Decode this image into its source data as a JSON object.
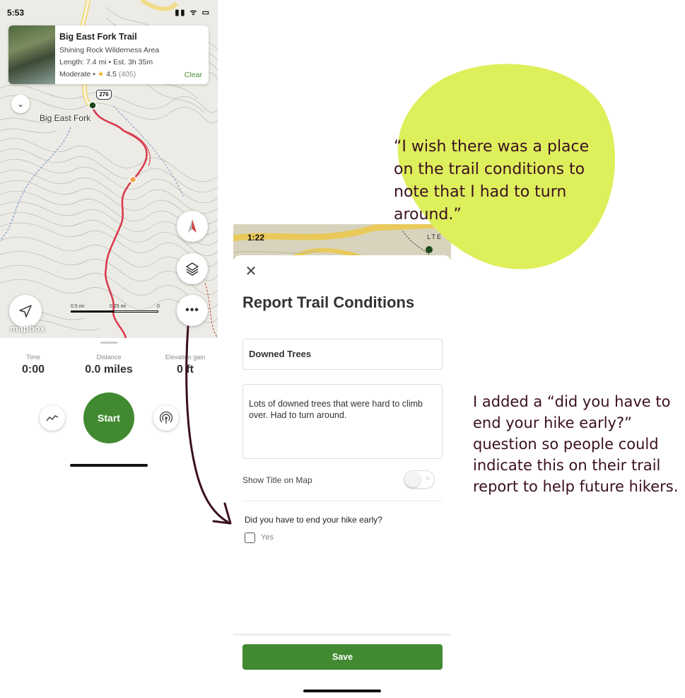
{
  "left_phone": {
    "status": {
      "time": "5:53",
      "icons": "▮▮ ᯤ ▭"
    },
    "trail_card": {
      "title": "Big East Fork Trail",
      "area": "Shining Rock Wilderness Area",
      "length": "Length: 7.4 mi",
      "est": "Est. 3h 35m",
      "difficulty": "Moderate",
      "rating": "4.5",
      "reviews": "(405)",
      "clear_label": "Clear"
    },
    "map": {
      "place_label": "Big East Fork",
      "route_shield": "276",
      "scale": {
        "a": "0.5 mi",
        "b": "0.25 mi",
        "c": "0"
      },
      "attribution": "mapbox"
    },
    "stats": {
      "time_label": "Time",
      "time_value": "0:00",
      "distance_label": "Distance",
      "distance_value": "0.0 miles",
      "elevation_label": "Elevation gain",
      "elevation_value": "0 ft"
    },
    "start_label": "Start",
    "colors": {
      "brand_green": "#428a31",
      "trail_red": "#d9374a"
    }
  },
  "right_phone": {
    "status": {
      "time": "1:22",
      "icons": "LTE"
    },
    "title": "Report Trail Conditions",
    "report_title": "Downed Trees",
    "report_body": "Lots of downed trees that were hard to climb over. Had to turn around.",
    "toggle_label": "Show Title on Map",
    "question": "Did you have to end your hike early?",
    "checkbox_label": "Yes",
    "save_label": "Save"
  },
  "annotations": {
    "quote": "“I wish there was a place on the trail conditions to note that I had to turn around.”",
    "note": "I added a “did you have to end your hike early?” question so people could indicate this on their trail report to help future hikers.",
    "blob_color": "#deef5c",
    "text_color": "#3a1020"
  }
}
